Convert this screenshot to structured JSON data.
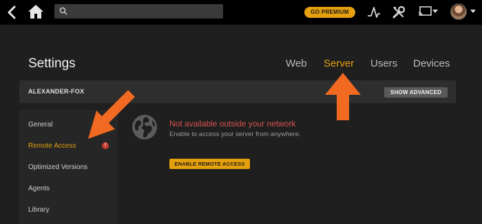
{
  "topbar": {
    "search_value": "",
    "premium_label": "GO PREMIUM",
    "icons": [
      "back-icon",
      "home-icon",
      "search-icon",
      "activity-icon",
      "tools-icon",
      "cast-icon",
      "avatar"
    ]
  },
  "settings": {
    "title": "Settings",
    "tabs": [
      {
        "label": "Web"
      },
      {
        "label": "Server",
        "active": true
      },
      {
        "label": "Users"
      },
      {
        "label": "Devices"
      }
    ]
  },
  "server": {
    "name": "ALEXANDER-FOX",
    "show_advanced_label": "SHOW ADVANCED"
  },
  "sidebar": {
    "items": [
      {
        "label": "General"
      },
      {
        "label": "Remote Access",
        "active": true,
        "warning": "!"
      },
      {
        "label": "Optimized Versions"
      },
      {
        "label": "Agents"
      },
      {
        "label": "Library"
      }
    ]
  },
  "remote_access": {
    "status_title": "Not available outside your network",
    "description": "Enable to access your server from anywhere.",
    "enable_label": "ENABLE REMOTE ACCESS"
  },
  "colors": {
    "accent": "#e5a00d",
    "error": "#d9534f",
    "arrow": "#f26a21"
  }
}
